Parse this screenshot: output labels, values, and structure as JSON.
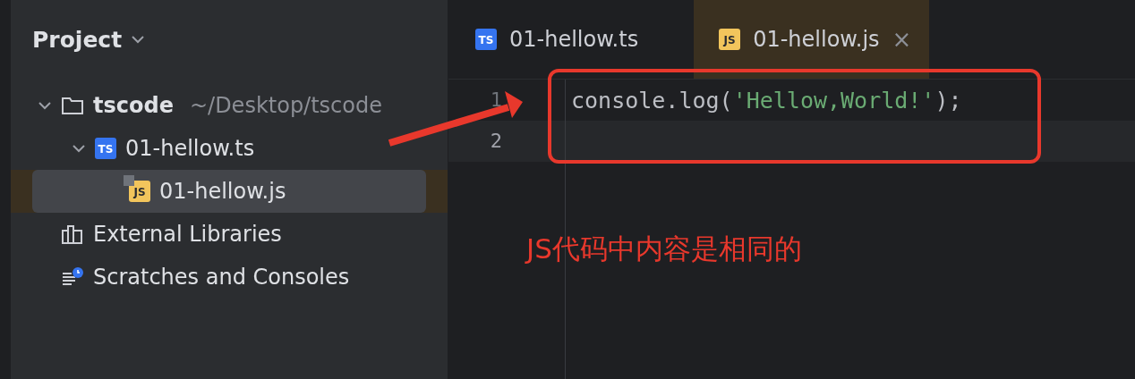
{
  "sidebar": {
    "title": "Project",
    "tree": [
      {
        "kind": "folder",
        "label": "tscode",
        "hint": "~/Desktop/tscode",
        "expanded": true,
        "selected": false,
        "children": [
          {
            "kind": "ts",
            "badge": "TS",
            "label": "01-hellow.ts",
            "expanded": true,
            "selected": false,
            "children": [
              {
                "kind": "js",
                "badge": "JS",
                "label": "01-hellow.js",
                "selected": true
              }
            ]
          }
        ]
      },
      {
        "kind": "libraries",
        "label": "External Libraries",
        "selected": false
      },
      {
        "kind": "scratches",
        "label": "Scratches and Consoles",
        "selected": false
      }
    ]
  },
  "tabs": [
    {
      "kind": "ts",
      "badge": "TS",
      "label": "01-hellow.ts",
      "selected": false
    },
    {
      "kind": "js",
      "badge": "JS",
      "label": "01-hellow.js",
      "selected": true,
      "close": "×"
    }
  ],
  "editor": {
    "lines": [
      {
        "number": "1",
        "current": false,
        "tokens": [
          {
            "kind": "plain",
            "text": "console.log("
          },
          {
            "kind": "string",
            "text": "'Hellow,World!'"
          },
          {
            "kind": "plain",
            "text": ");"
          }
        ]
      },
      {
        "number": "2",
        "current": true
      }
    ]
  },
  "annotation": {
    "text": "JS代码中内容是相同的"
  }
}
